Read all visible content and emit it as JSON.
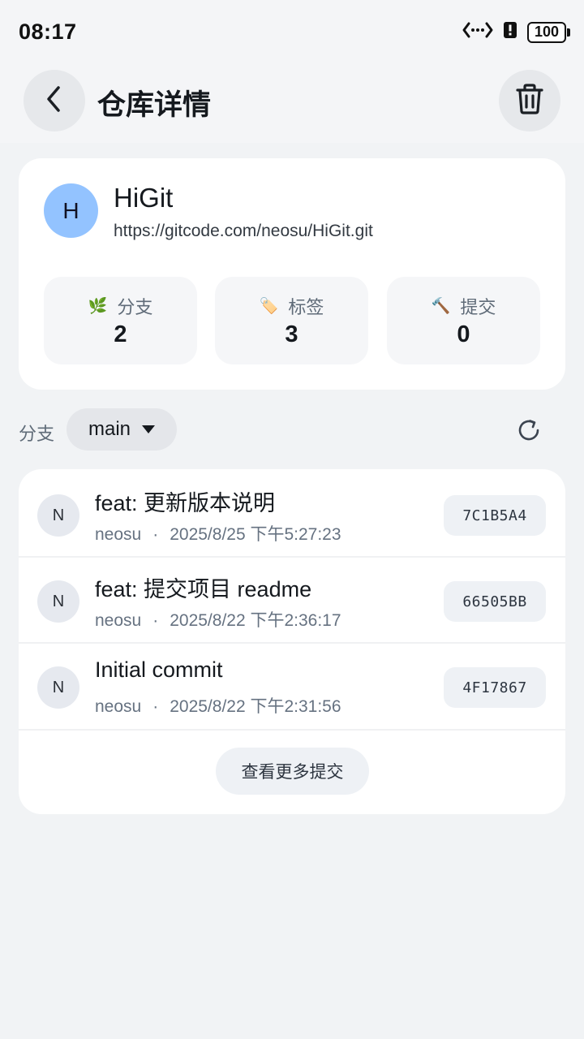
{
  "status_bar": {
    "time": "08:17",
    "battery": "100"
  },
  "header": {
    "title": "仓库详情"
  },
  "repo": {
    "avatar_initial": "H",
    "name": "HiGit",
    "url": "https://gitcode.com/neosu/HiGit.git",
    "stats": [
      {
        "icon": "🌿",
        "label": "分支",
        "value": "2"
      },
      {
        "icon": "🏷️",
        "label": "标签",
        "value": "3"
      },
      {
        "icon": "🔨",
        "label": "提交",
        "value": "0"
      }
    ]
  },
  "branch": {
    "label": "分支",
    "selected": "main"
  },
  "commits": [
    {
      "avatar": "N",
      "message": "feat: 更新版本说明",
      "author": "neosu",
      "sep": "·",
      "date": "2025/8/25 下午5:27:23",
      "hash": "7C1B5A4"
    },
    {
      "avatar": "N",
      "message": "feat: 提交项目 readme",
      "author": "neosu",
      "sep": "·",
      "date": "2025/8/22 下午2:36:17",
      "hash": "66505BB"
    },
    {
      "avatar": "N",
      "message": "Initial commit",
      "author": "neosu",
      "sep": "·",
      "date": "2025/8/22 下午2:31:56",
      "hash": "4F17867"
    }
  ],
  "more_button": "查看更多提交"
}
